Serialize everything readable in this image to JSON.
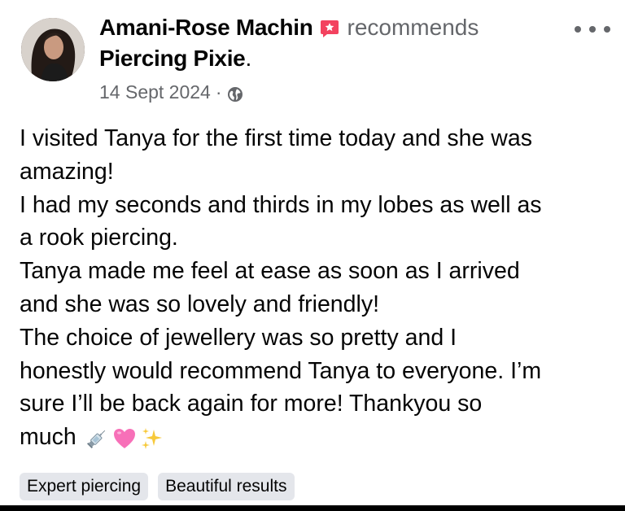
{
  "post": {
    "author": "Amani-Rose Machin",
    "action": "recommends",
    "page": "Piercing Pixie",
    "page_suffix": ".",
    "date": "14 Sept 2024",
    "date_separator": "·",
    "audience_icon": "globe-icon",
    "recommend_icon": "recommend-badge-icon",
    "more_icon": "more-options-icon",
    "body_lines": [
      "I visited Tanya for the first time today and she was",
      "amazing!",
      "I had my seconds and thirds in my lobes as well as",
      "a rook piercing.",
      "Tanya made me feel at ease as soon as I arrived",
      "and she was so lovely and friendly!",
      "The choice of jewellery was so pretty and I",
      "honestly would recommend Tanya to everyone. I’m",
      "sure I’ll be back again for more! Thankyou so",
      "much"
    ],
    "emojis": [
      "syringe-emoji",
      "pink-heart-emoji",
      "sparkles-emoji"
    ]
  },
  "tags": [
    "Expert piercing",
    "Beautiful results"
  ],
  "colors": {
    "text": "#050505",
    "secondary_text": "#65676b",
    "tag_background": "#e4e6eb",
    "recommend_badge": "#f3425f"
  }
}
